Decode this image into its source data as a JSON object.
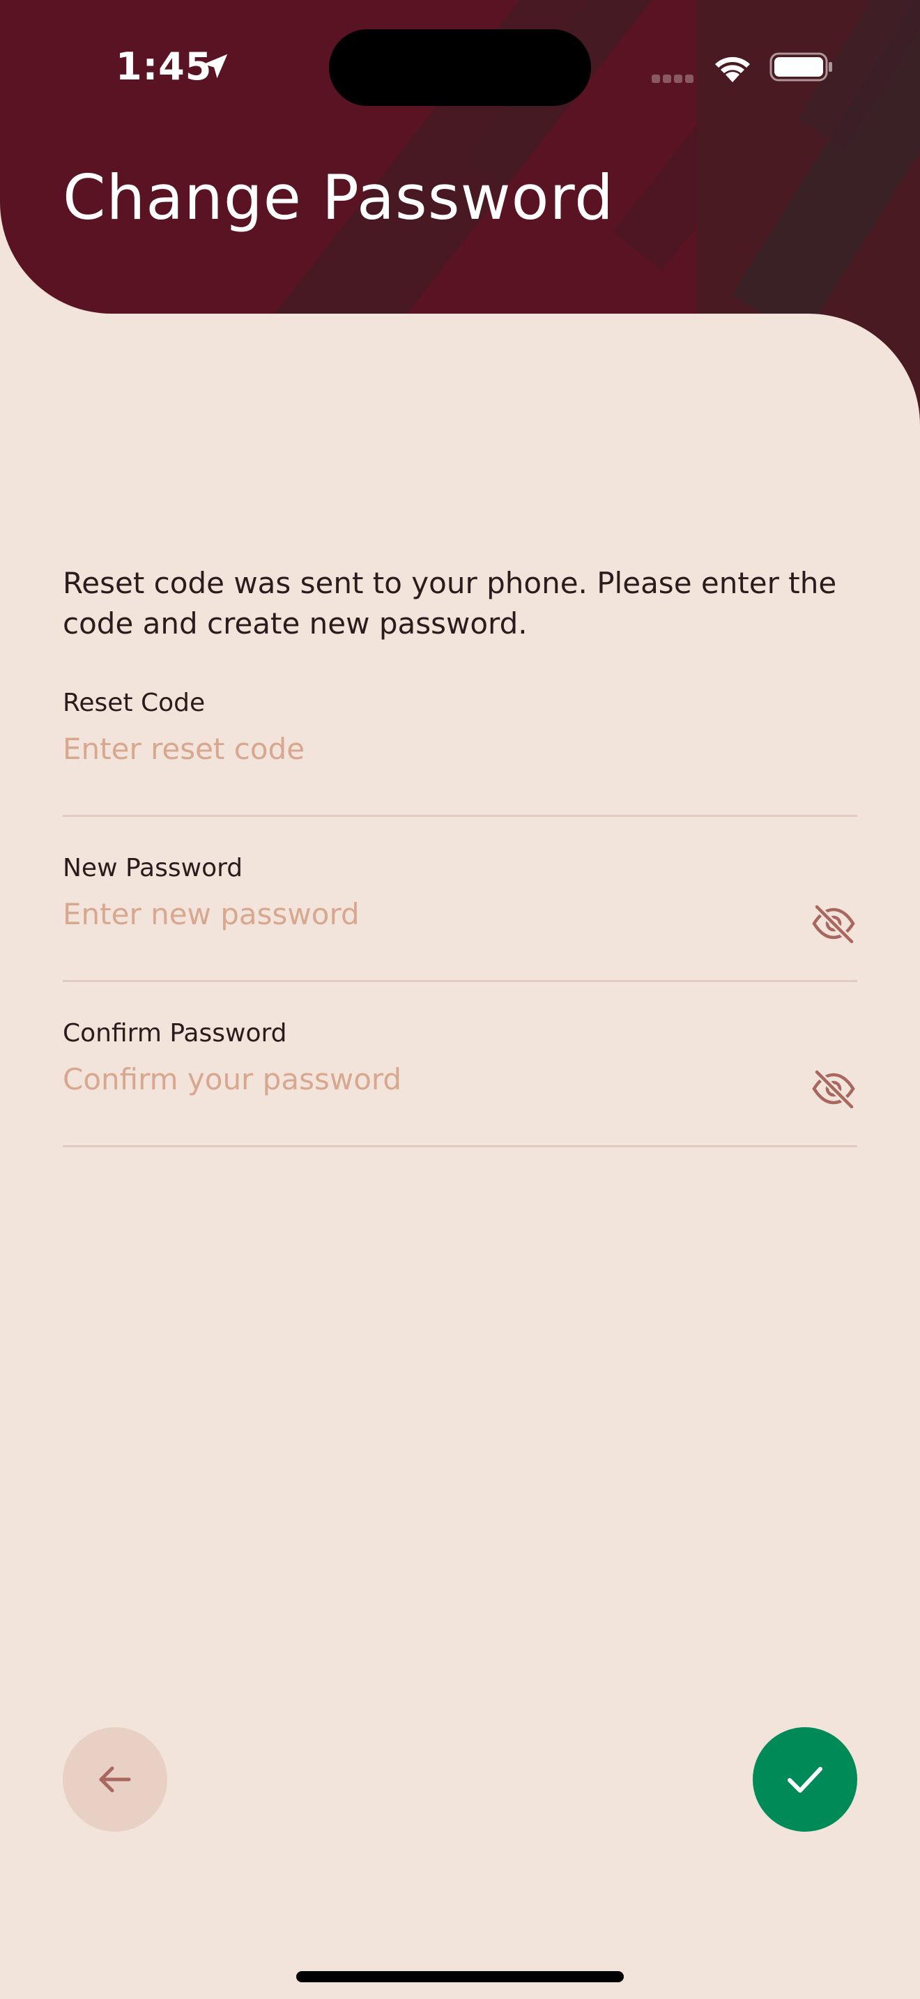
{
  "status_bar": {
    "time": "1:45",
    "location_icon": "location-arrow-icon",
    "wifi_icon": "wifi-icon",
    "battery_icon": "battery-icon"
  },
  "header": {
    "title": "Change Password"
  },
  "instructions": "Reset code was sent to your phone. Please enter the code and create new password.",
  "form": {
    "reset_code": {
      "label": "Reset Code",
      "placeholder": "Enter reset code",
      "value": ""
    },
    "new_password": {
      "label": "New Password",
      "placeholder": "Enter new password",
      "value": "",
      "toggle_icon": "eye-off-icon"
    },
    "confirm_password": {
      "label": "Confirm Password",
      "placeholder": "Confirm your password",
      "value": "",
      "toggle_icon": "eye-off-icon"
    }
  },
  "actions": {
    "back_icon": "arrow-left-icon",
    "confirm_icon": "checkmark-icon"
  },
  "colors": {
    "header_background": "#5A1322",
    "page_background": "#F2E4DA",
    "placeholder": "#D7A78F",
    "back_button": "#E9D0C4",
    "confirm_button": "#008A58",
    "icon_muted": "#A8675F"
  }
}
